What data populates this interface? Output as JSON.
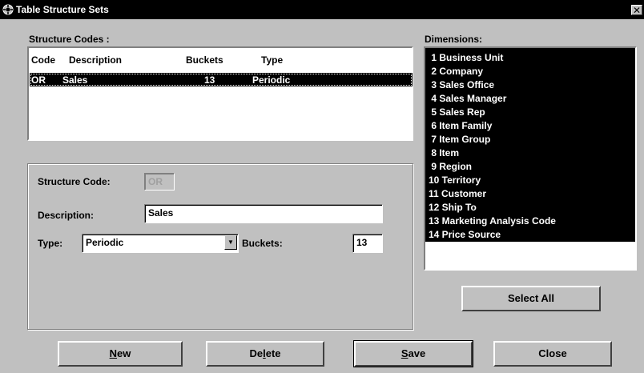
{
  "window": {
    "title": "Table Structure Sets",
    "close_glyph": "✕"
  },
  "structure_codes": {
    "label": "Structure Codes :",
    "columns": [
      "Code",
      "Description",
      "Buckets",
      "Type"
    ],
    "rows": [
      {
        "code": "OR",
        "description": "Sales",
        "buckets": "13",
        "type": "Periodic",
        "selected": true
      }
    ]
  },
  "form": {
    "structure_code_label": "Structure Code:",
    "structure_code_value": "OR",
    "description_label": "Description:",
    "description_value": "Sales",
    "type_label": "Type:",
    "type_value": "Periodic",
    "buckets_label": "Buckets:",
    "buckets_value": "13"
  },
  "dimensions": {
    "label": "Dimensions:",
    "items": [
      " 1 Business Unit",
      " 2 Company",
      " 3 Sales Office",
      " 4 Sales Manager",
      " 5 Sales Rep",
      " 6 Item Family",
      " 7 Item Group",
      " 8 Item",
      " 9 Region",
      "10 Territory",
      "11 Customer",
      "12 Ship To",
      "13 Marketing Analysis Code",
      "14 Price Source"
    ]
  },
  "buttons": {
    "select_all": "Select All",
    "new": {
      "pre": "",
      "mnemonic": "N",
      "post": "ew"
    },
    "delete": {
      "pre": "De",
      "mnemonic": "l",
      "post": "ete"
    },
    "save": {
      "pre": "",
      "mnemonic": "S",
      "post": "ave"
    },
    "close": "Close"
  },
  "colors": {
    "face": "#c0c0c0",
    "titlebar": "#000000",
    "selection": "#000000"
  }
}
